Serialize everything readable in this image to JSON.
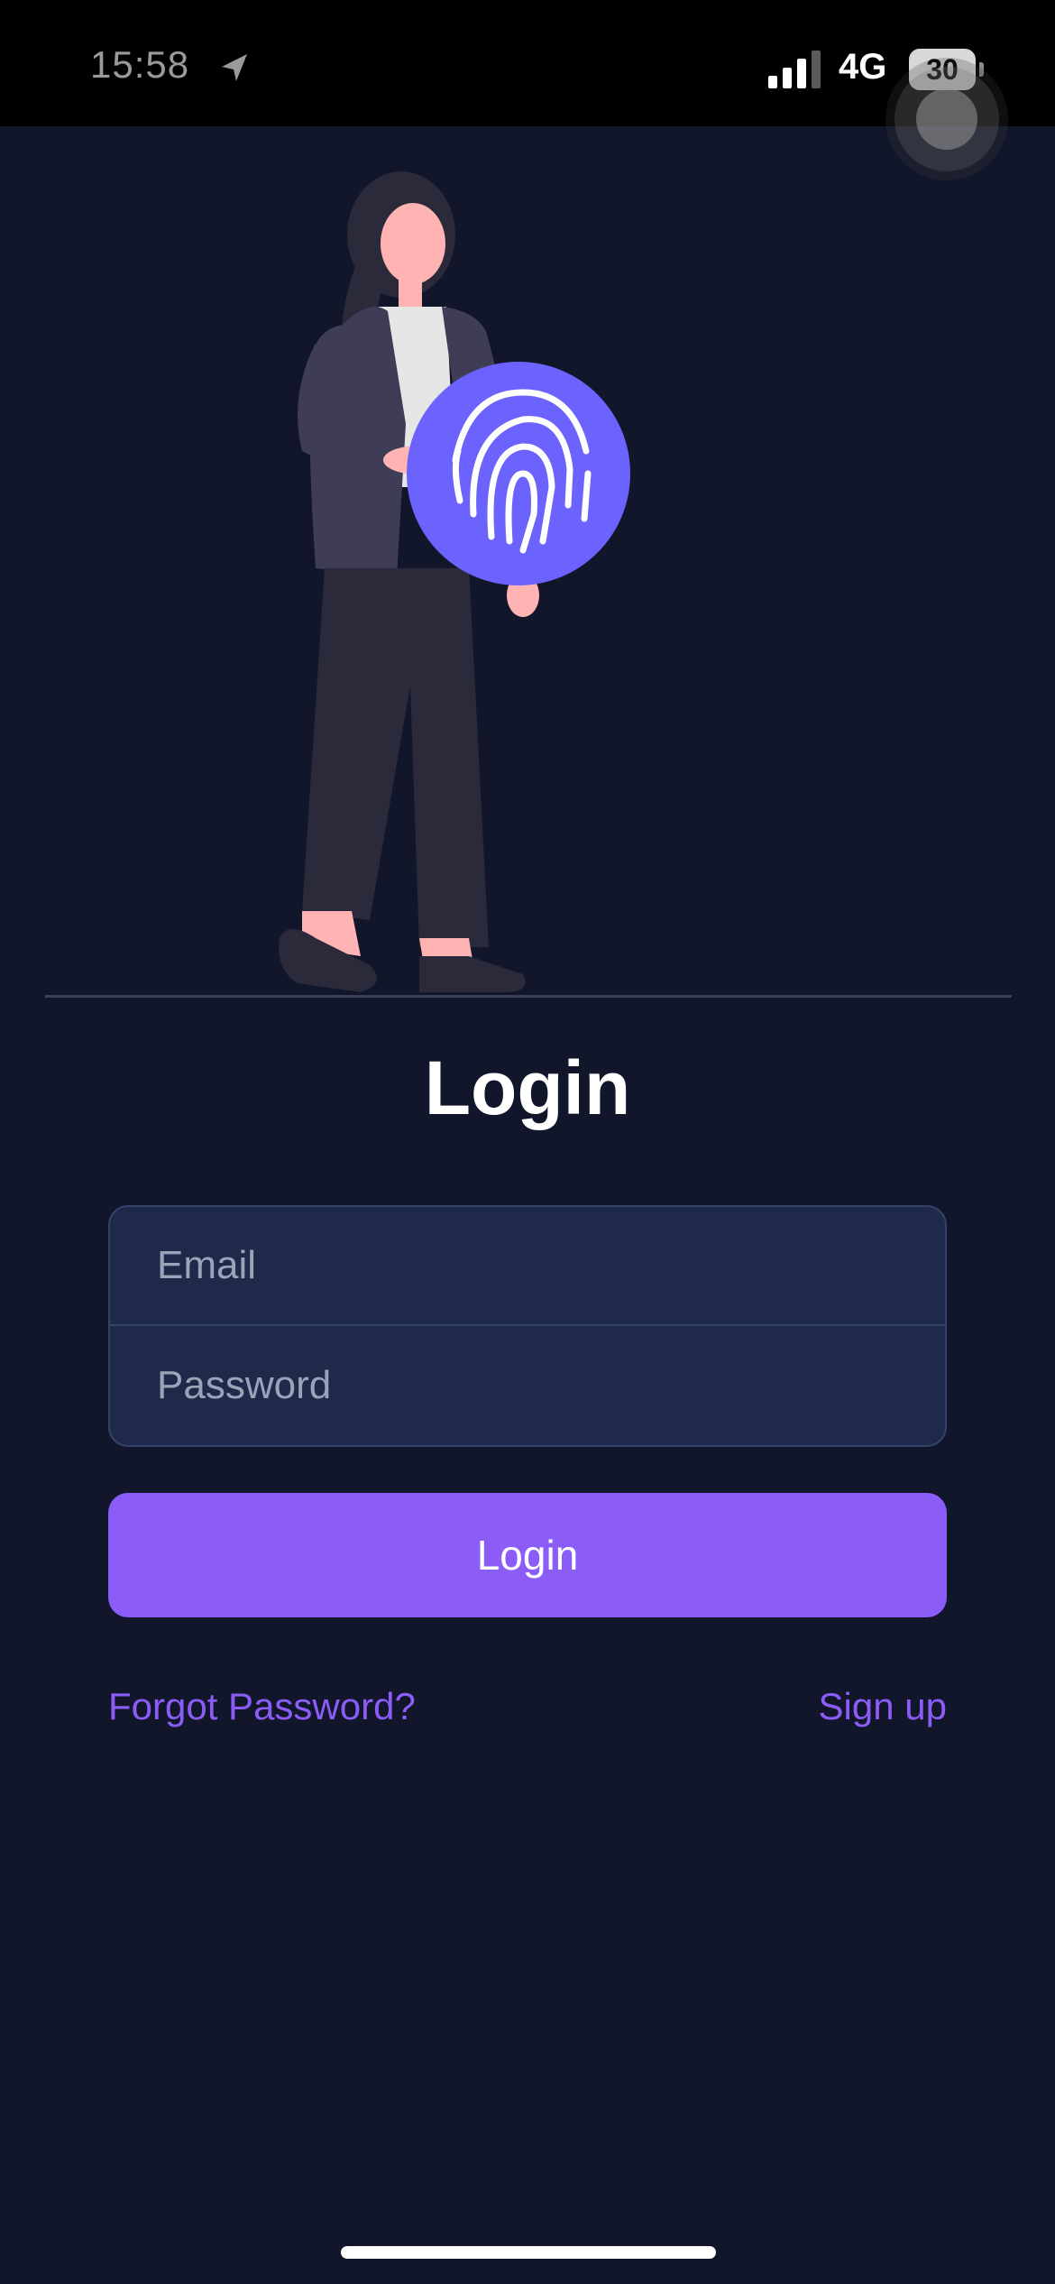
{
  "status_bar": {
    "time": "15:58",
    "network": "4G",
    "battery": "30",
    "icons": [
      "location-arrow-icon",
      "signal-bars-icon",
      "battery-icon"
    ]
  },
  "screen": {
    "title": "Login",
    "email_placeholder": "Email",
    "password_placeholder": "Password",
    "login_button_label": "Login",
    "forgot_password_link": "Forgot Password?",
    "signup_link": "Sign up"
  },
  "colors": {
    "background": "#11162a",
    "input_background": "#1f2a4a",
    "accent": "#8b5cf6",
    "fingerprint_badge": "#6c63ff"
  }
}
